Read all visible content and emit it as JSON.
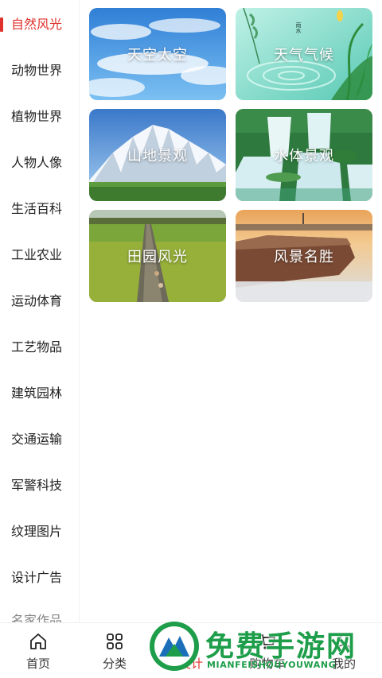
{
  "sidebar": {
    "items": [
      {
        "label": "自然风光",
        "active": true
      },
      {
        "label": "动物世界"
      },
      {
        "label": "植物世界"
      },
      {
        "label": "人物人像"
      },
      {
        "label": "生活百科"
      },
      {
        "label": "工业农业"
      },
      {
        "label": "运动体育"
      },
      {
        "label": "工艺物品"
      },
      {
        "label": "建筑园林"
      },
      {
        "label": "交通运输"
      },
      {
        "label": "军警科技"
      },
      {
        "label": "纹理图片"
      },
      {
        "label": "设计广告"
      },
      {
        "label": "名家作品"
      }
    ],
    "accent_color": "#e0322c"
  },
  "grid": {
    "cards": [
      {
        "label": "天空太空"
      },
      {
        "label": "天气气候",
        "poster_text": "雨水"
      },
      {
        "label": "山地景观"
      },
      {
        "label": "水体景观"
      },
      {
        "label": "田园风光"
      },
      {
        "label": "风景名胜"
      }
    ]
  },
  "tabbar": {
    "tabs": [
      {
        "label": "首页",
        "icon": "home-icon"
      },
      {
        "label": "分类",
        "icon": "grid-icon"
      },
      {
        "label": "设计",
        "icon": "design-icon"
      },
      {
        "label": "购物车",
        "icon": "cart-icon"
      },
      {
        "label": "我的",
        "icon": "user-icon"
      }
    ]
  },
  "watermark": {
    "title": "免费手游网",
    "subtitle": "MIANFEISHOUYOUWANG",
    "color": "#1e9e4a"
  }
}
